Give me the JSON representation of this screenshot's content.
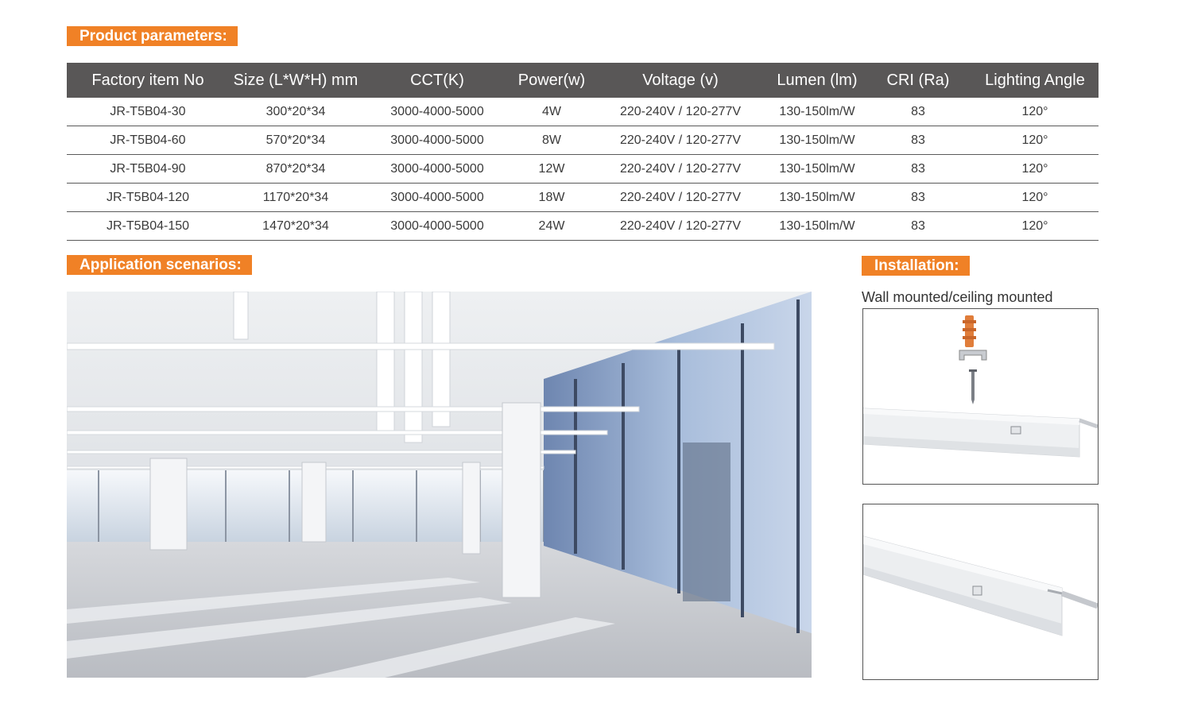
{
  "sections": {
    "params_title": "Product parameters:",
    "app_title": "Application scenarios:",
    "install_title": "Installation:",
    "install_label": "Wall mounted/ceiling mounted"
  },
  "table": {
    "headers": [
      "Factory item No",
      "Size (L*W*H) mm",
      "CCT(K)",
      "Power(w)",
      "Voltage (v)",
      "Lumen (lm)",
      "CRI (Ra)",
      "Lighting Angle"
    ],
    "rows": [
      [
        "JR-T5B04-30",
        "300*20*34",
        "3000-4000-5000",
        "4W",
        "220-240V / 120-277V",
        "130-150lm/W",
        "83",
        "120°"
      ],
      [
        "JR-T5B04-60",
        "570*20*34",
        "3000-4000-5000",
        "8W",
        "220-240V / 120-277V",
        "130-150lm/W",
        "83",
        "120°"
      ],
      [
        "JR-T5B04-90",
        "870*20*34",
        "3000-4000-5000",
        "12W",
        "220-240V / 120-277V",
        "130-150lm/W",
        "83",
        "120°"
      ],
      [
        "JR-T5B04-120",
        "1170*20*34",
        "3000-4000-5000",
        "18W",
        "220-240V / 120-277V",
        "130-150lm/W",
        "83",
        "120°"
      ],
      [
        "JR-T5B04-150",
        "1470*20*34",
        "3000-4000-5000",
        "24W",
        "220-240V / 120-277V",
        "130-150lm/W",
        "83",
        "120°"
      ]
    ]
  },
  "colors": {
    "accent": "#f08126",
    "header_bg": "#595757"
  }
}
